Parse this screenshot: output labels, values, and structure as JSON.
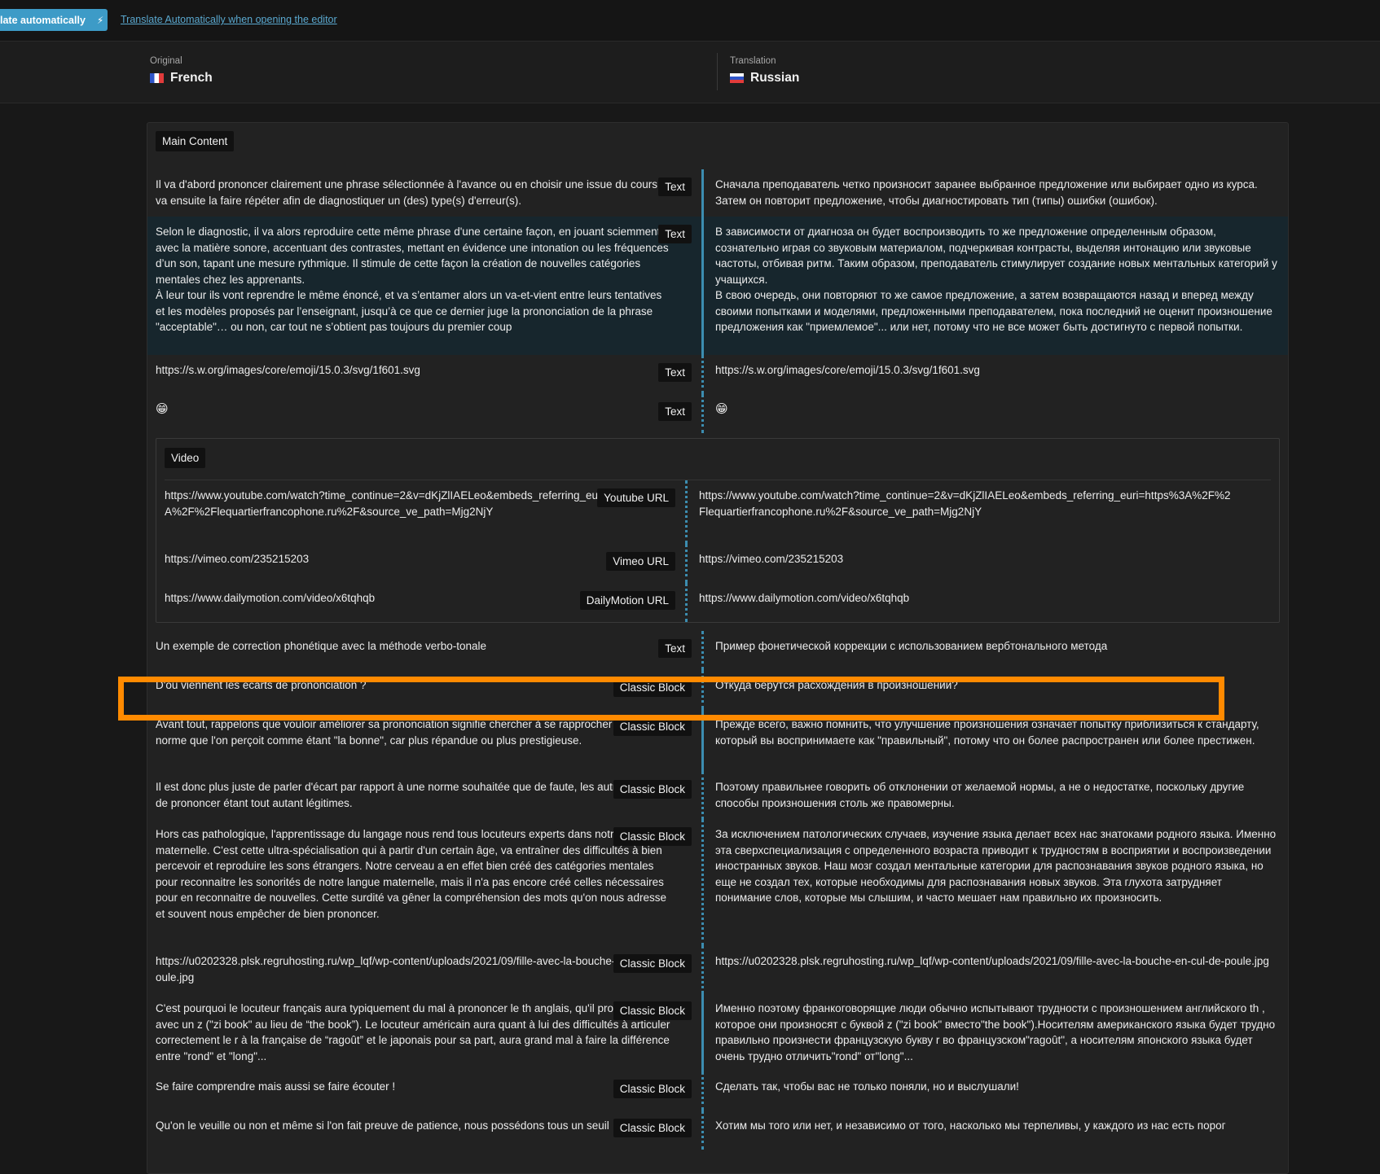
{
  "topbar": {
    "auto_button_label": "late automatically",
    "auto_button_icon": "lightning-icon",
    "auto_link": "Translate Automatically when opening the editor"
  },
  "languages": {
    "original_caption": "Original",
    "original_name": "French",
    "translation_caption": "Translation",
    "translation_name": "Russian"
  },
  "main": {
    "section_label": "Main Content",
    "rows": [
      {
        "badge": "Text",
        "orig": "Il va d'abord prononcer clairement une phrase sélectionnée à l'avance ou en choisir une issue du cours. Il va ensuite la faire répéter afin de diagnostiquer un (des) type(s) d'erreur(s).",
        "trans": "Сначала преподаватель четко произносит заранее выбранное предложение или выбирает одно из курса. Затем он повторит предложение, чтобы диагностировать тип (типы) ошибки (ошибок)."
      },
      {
        "badge": "Text",
        "orig_p1": "Selon le diagnostic, il va alors reproduire cette même phrase d'une certaine façon, en jouant sciemment avec la matière sonore, accentuant des contrastes, mettant en évidence une intonation ou les fréquences d’un son, tapant une mesure rythmique. Il stimule de cette façon la création de nouvelles catégories mentales chez les apprenants.",
        "orig_p2": "À leur tour ils vont reprendre le même énoncé, et va s’entamer alors un va-et-vient entre leurs tentatives et les modèles proposés par l’enseignant, jusqu’à ce que ce dernier juge la prononciation de la phrase \"acceptable\"… ou non, car tout ne s’obtient pas toujours du premier coup",
        "trans_p1": "В зависимости от диагноза он будет воспроизводить то же предложение определенным образом, сознательно играя со звуковым материалом, подчеркивая контрасты, выделяя интонацию или звуковые частоты, отбивая ритм. Таким образом, преподаватель стимулирует создание новых ментальных категорий у учащихся.",
        "trans_p2": "В свою очередь, они повторяют то же самое предложение, а затем возвращаются назад и вперед между своими попытками и моделями, предложенными преподавателем, пока последний не оценит произношение предложения как \"приемлемое\"... или нет, потому что не все может быть достигнуто с первой попытки."
      },
      {
        "badge": "Text",
        "orig": "https://s.w.org/images/core/emoji/15.0.3/svg/1f601.svg",
        "trans": "https://s.w.org/images/core/emoji/15.0.3/svg/1f601.svg"
      },
      {
        "badge": "Text",
        "orig": "😁",
        "trans": "😁"
      }
    ],
    "video": {
      "section_label": "Video",
      "rows": [
        {
          "badge": "Youtube URL",
          "orig": "https://www.youtube.com/watch?time_continue=2&v=dKjZlIAELeo&embeds_referring_euri=https%3A%2F%2Flequartierfrancophone.ru%2F&source_ve_path=Mjg2NjY",
          "trans": "https://www.youtube.com/watch?time_continue=2&v=dKjZlIAELeo&embeds_referring_euri=https%3A%2F%2Flequartierfrancophone.ru%2F&source_ve_path=Mjg2NjY"
        },
        {
          "badge": "Vimeo URL",
          "orig": "https://vimeo.com/235215203",
          "trans": "https://vimeo.com/235215203"
        },
        {
          "badge": "DailyMotion URL",
          "orig": "https://www.dailymotion.com/video/x6tqhqb",
          "trans": "https://www.dailymotion.com/video/x6tqhqb"
        }
      ]
    },
    "rows2": [
      {
        "badge": "Text",
        "orig": "Un exemple de correction phonétique avec la méthode verbo-tonale",
        "trans": "Пример фонетической коррекции с использованием вербтонального метода"
      },
      {
        "badge": "Classic Block",
        "orig": "D'où viennent les écarts de prononciation ?",
        "trans": "Откуда берутся расхождения в произношении?"
      },
      {
        "badge": "Classic Block",
        "orig": "Avant tout, rappelons que vouloir améliorer sa prononciation signifie chercher à se rapprocher d'une norme que l'on perçoit comme étant \"la bonne\", car plus répandue ou plus prestigieuse.",
        "trans": "Прежде всего, важно помнить, что улучшение произношения означает попытку приблизиться к стандарту, который вы воспринимаете как \"правильный\", потому что он более распространен или более престижен."
      },
      {
        "badge": "Classic Block",
        "orig": "Il est donc plus juste de parler d'écart par rapport à une norme souhaitée que de faute, les autres façons de prononcer étant tout autant légitimes.",
        "trans": "Поэтому правильнее говорить об отклонении от желаемой нормы, а не о недостатке, поскольку другие способы произношения столь же правомерны."
      },
      {
        "badge": "Classic Block",
        "orig": "Hors cas pathologique, l'apprentissage du langage nous rend tous locuteurs experts dans notre langue maternelle. C'est cette ultra-spécialisation qui à partir d'un certain âge, va entraîner des difficultés à bien percevoir et reproduire les sons étrangers. Notre cerveau a en effet bien créé des catégories mentales pour reconnaitre les sonorités de notre langue maternelle, mais il n'a pas encore créé celles nécessaires pour en reconnaitre de nouvelles. Cette surdité va gêner la compréhension des mots qu'on nous adresse et souvent nous empêcher de bien prononcer.",
        "trans": "За исключением патологических случаев, изучение языка делает всех нас знатоками родного языка. Именно эта сверхспециализация с определенного возраста приводит к трудностям в восприятии и воспроизведении иностранных звуков. Наш мозг создал ментальные категории для распознавания звуков родного языка, но еще не создал тех, которые необходимы для распознавания новых звуков. Эта глухота затрудняет понимание слов, которые мы слышим, и часто мешает нам правильно их произносить."
      },
      {
        "badge": "Classic Block",
        "orig": "https://u0202328.plsk.regruhosting.ru/wp_lqf/wp-content/uploads/2021/09/fille-avec-la-bouche-en-cul-de-poule.jpg",
        "trans": "https://u0202328.plsk.regruhosting.ru/wp_lqf/wp-content/uploads/2021/09/fille-avec-la-bouche-en-cul-de-poule.jpg"
      },
      {
        "badge": "Classic Block",
        "orig": "C'est pourquoi le locuteur français aura typiquement du mal à prononcer le th anglais, qu'il prononcera avec un z (\"zi book\" au lieu de “the book”). Le locuteur américain aura quant à lui des difficultés à articuler correctement le r à la française de “ragoût” et le japonais pour sa part, aura grand mal à faire la différence entre \"rond\" et \"long\"...",
        "trans": "Именно поэтому франкоговорящие люди обычно испытывают трудности с произношением английского th , которое они произносят с буквой z (\"zi book\" вместо\"the book\").Носителям американского языка будет трудно правильно произнести французскую букву r во французском\"ragoût\", а носителям японского языка будет очень трудно отличить\"rond\" от\"long\"..."
      },
      {
        "badge": "Classic Block",
        "orig": "Se faire comprendre mais aussi se faire écouter !",
        "trans": "Сделать так, чтобы вас не только поняли, но и выслушали!"
      },
      {
        "badge": "Classic Block",
        "orig": "Qu'on le veuille ou non et même si l'on fait preuve de patience, nous possédons tous un seuil",
        "trans": "Хотим мы того или нет, и независимо от того, насколько мы терпеливы, у каждого из нас есть порог"
      }
    ]
  }
}
